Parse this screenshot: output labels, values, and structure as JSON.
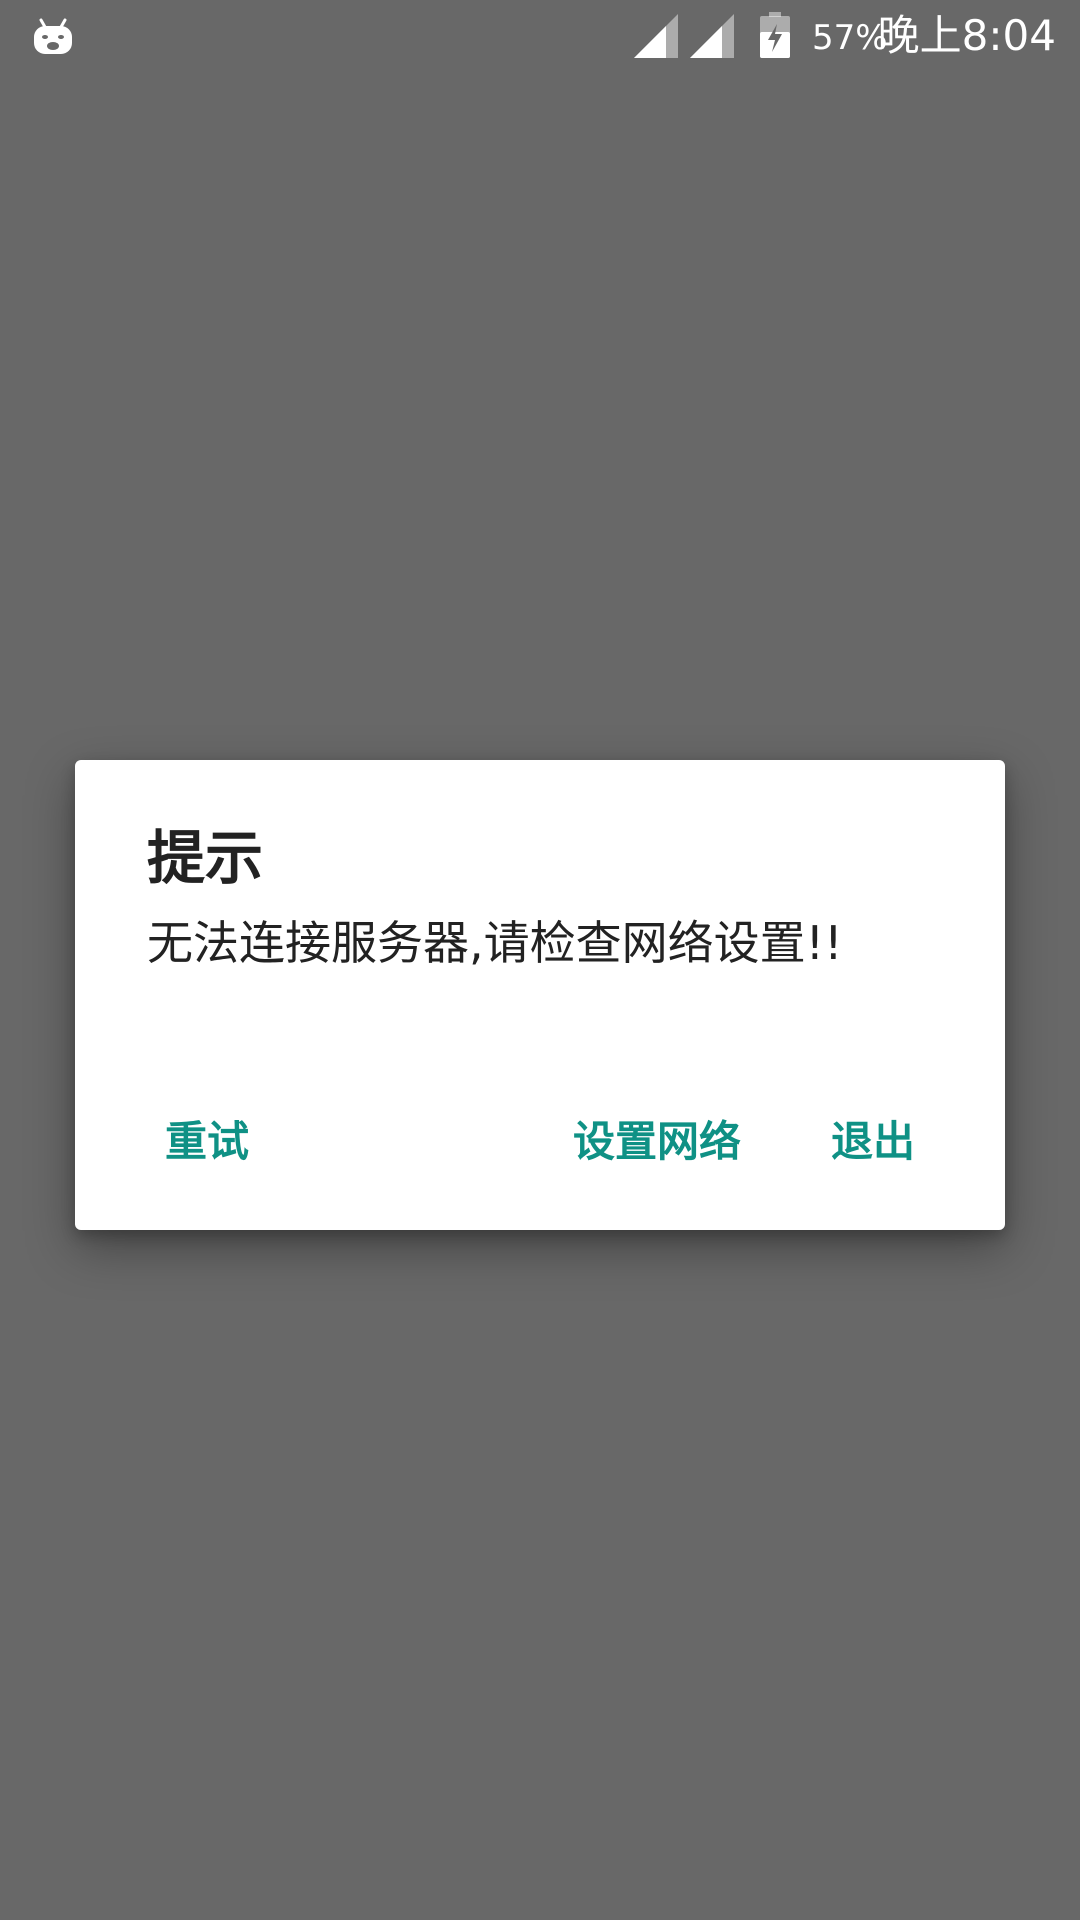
{
  "status_bar": {
    "notification_icon": "android-robot-icon",
    "signal_icons": [
      "cell-signal-icon",
      "cell-signal-icon"
    ],
    "battery_icon": "battery-charging-icon",
    "battery_percent": "57%",
    "time": "晚上8:04"
  },
  "dialog": {
    "title": "提示",
    "message": "无法连接服务器,请检查网络设置!!",
    "buttons": {
      "retry": "重试",
      "network_settings": "设置网络",
      "exit": "退出"
    }
  },
  "colors": {
    "scrim": "#686868",
    "dialog_background": "#ffffff",
    "text": "#222222",
    "accent": "#0f9185"
  }
}
